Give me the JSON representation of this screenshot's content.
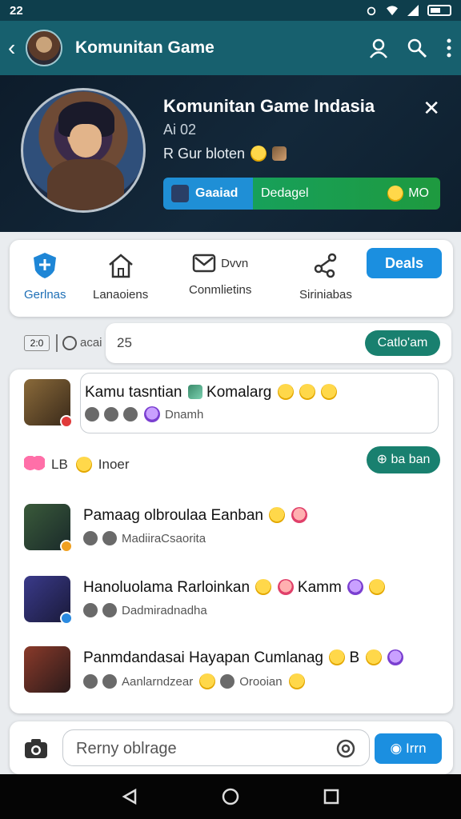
{
  "status": {
    "left": "22",
    "colors": {
      "bar": "#0e3e4c"
    }
  },
  "appbar": {
    "title": "Komunitan Game",
    "color": "#17606e"
  },
  "banner": {
    "title": "Komunitan Game Indasia",
    "subtitle": "Ai 02",
    "line2": "R Gur bloten",
    "bar_left": "Gaaiad",
    "bar_middle": "Dedagel",
    "bar_right": "MO"
  },
  "nav": {
    "items": [
      {
        "label": "Gerlnas",
        "icon": "shield-icon"
      },
      {
        "label": "Lanaoiens",
        "icon": "home-icon"
      },
      {
        "label": "Conmlietins",
        "icon": "mail-icon",
        "extra": "Dvvn"
      },
      {
        "label": "Siriniabas",
        "icon": "share-icon"
      }
    ],
    "deals_label": "Deals"
  },
  "filter": {
    "count": "2:0",
    "label": "acai",
    "input_value": "25",
    "button": "Catlo'am"
  },
  "chat": {
    "pinned": {
      "title": "Kamu tasntian",
      "title_tail": "Komalarg",
      "meta": "Dnamh"
    },
    "user": {
      "name": "LB",
      "role": "Inoer"
    },
    "reply_label": "ba ban",
    "messages": [
      {
        "title": "Pamaag olbroulaa Eanban",
        "meta": "MadiiraCsaorita"
      },
      {
        "title": "Hanoluolama Rarloinkan",
        "title_tail": "Kamm",
        "meta": "Dadmiradnadha"
      },
      {
        "title": "Panmdandasai Hayapan Cumlanag",
        "title_tail": "B",
        "meta": "Aanlarndzear",
        "meta2": "Orooian"
      }
    ]
  },
  "composer": {
    "placeholder": "Rerny oblrage",
    "send_label": "Irrn"
  }
}
